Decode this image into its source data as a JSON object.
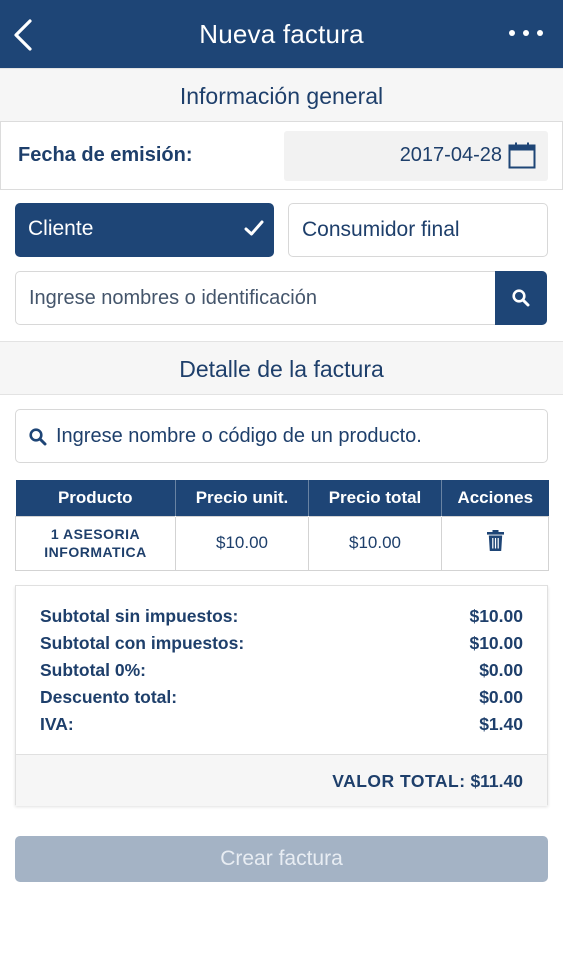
{
  "header": {
    "title": "Nueva factura"
  },
  "sections": {
    "general": "Información general",
    "detail": "Detalle de la factura"
  },
  "date": {
    "label": "Fecha de emisión:",
    "value": "2017-04-28"
  },
  "client_type": {
    "cliente": "Cliente",
    "consumidor": "Consumidor final",
    "selected": "cliente"
  },
  "client_search": {
    "placeholder": "Ingrese nombres o identificación"
  },
  "product_search": {
    "placeholder": "Ingrese nombre o código de un producto."
  },
  "table": {
    "headers": [
      "Producto",
      "Precio unit.",
      "Precio total",
      "Acciones"
    ],
    "rows": [
      {
        "product_line1": "1 ASESORIA",
        "product_line2": "INFORMATICA",
        "unit_price": "$10.00",
        "total_price": "$10.00"
      }
    ]
  },
  "summary": {
    "rows": [
      {
        "label": "Subtotal sin impuestos:",
        "value": "$10.00"
      },
      {
        "label": "Subtotal con impuestos:",
        "value": "$10.00"
      },
      {
        "label": "Subtotal 0%:",
        "value": "$0.00"
      },
      {
        "label": "Descuento total:",
        "value": "$0.00"
      },
      {
        "label": "IVA:",
        "value": "$1.40"
      }
    ],
    "total_label": "VALOR TOTAL:",
    "total_value": "$11.40"
  },
  "create_button": "Crear factura",
  "colors": {
    "primary": "#1e4576",
    "disabled": "#a4b3c5",
    "section_bg": "#f6f6f6"
  }
}
